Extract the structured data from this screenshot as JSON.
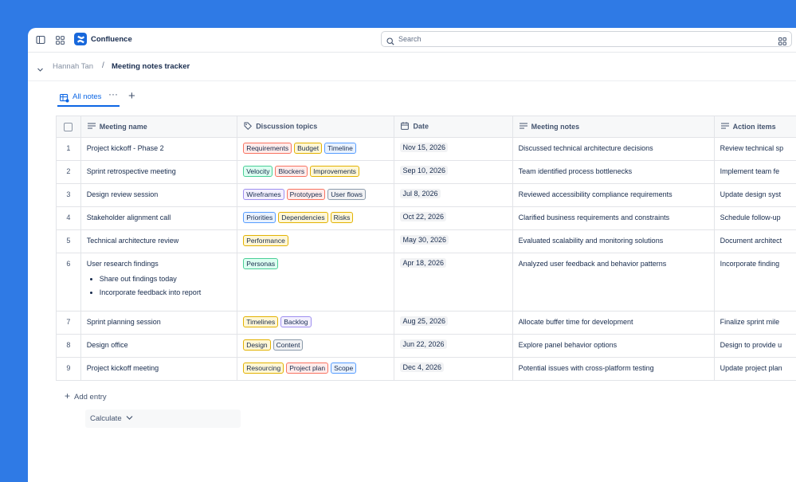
{
  "app": {
    "name": "Confluence",
    "brand_color": "#1868db",
    "background_color": "#2f7ae5"
  },
  "topbar": {
    "sidebar_toggle_icon": "sidebar-toggle-icon",
    "apps_icon": "apps-grid-icon",
    "search_placeholder": "Search",
    "search_icon": "search-icon",
    "search_right_icon": "filter-grid-icon"
  },
  "breadcrumb": {
    "user": "Hannah Tan",
    "separator": "/",
    "page": "Meeting notes tracker"
  },
  "tabs": {
    "active_label": "All notes",
    "more_label": "···",
    "add_label": "+"
  },
  "table": {
    "columns": [
      "Meeting name",
      "Discussion topics",
      "Date",
      "Meeting notes",
      "Action items"
    ],
    "rows": [
      {
        "num": "1",
        "name": "Project kickoff - Phase 2",
        "tags": [
          {
            "label": "Requirements",
            "color": "red"
          },
          {
            "label": "Budget",
            "color": "yellow"
          },
          {
            "label": "Timeline",
            "color": "blue"
          }
        ],
        "date": "Nov 15, 2026",
        "notes": "Discussed technical architecture decisions",
        "action": "Review technical sp"
      },
      {
        "num": "2",
        "name": "Sprint retrospective meeting",
        "tags": [
          {
            "label": "Velocity",
            "color": "green"
          },
          {
            "label": "Blockers",
            "color": "red"
          },
          {
            "label": "Improvements",
            "color": "yellow"
          }
        ],
        "date": "Sep 10, 2026",
        "notes": "Team identified process bottlenecks",
        "action": "Implement team fe"
      },
      {
        "num": "3",
        "name": "Design review session",
        "tags": [
          {
            "label": "Wireframes",
            "color": "purple"
          },
          {
            "label": "Prototypes",
            "color": "red"
          },
          {
            "label": "User flows",
            "color": "grey"
          }
        ],
        "date": "Jul 8, 2026",
        "notes": "Reviewed accessibility compliance requirements",
        "action": "Update design syst"
      },
      {
        "num": "4",
        "name": "Stakeholder alignment call",
        "tags": [
          {
            "label": "Priorities",
            "color": "blue"
          },
          {
            "label": "Dependencies",
            "color": "yellow"
          },
          {
            "label": "Risks",
            "color": "yellow"
          }
        ],
        "date": "Oct 22, 2026",
        "notes": "Clarified business requirements and constraints",
        "action": "Schedule follow-up"
      },
      {
        "num": "5",
        "name": "Technical architecture review",
        "tags": [
          {
            "label": "Performance",
            "color": "yellow"
          }
        ],
        "date": "May 30, 2026",
        "notes": "Evaluated scalability and monitoring solutions",
        "action": "Document architect"
      },
      {
        "num": "6",
        "name": "User research findings",
        "subitems": [
          "Share out findings today",
          "Incorporate feedback into report"
        ],
        "tags": [
          {
            "label": "Personas",
            "color": "green"
          }
        ],
        "date": "Apr 18, 2026",
        "notes": "Analyzed user feedback and behavior patterns",
        "action": "Incorporate finding"
      },
      {
        "num": "7",
        "name": "Sprint planning session",
        "tags": [
          {
            "label": "Timelines",
            "color": "yellow"
          },
          {
            "label": "Backlog",
            "color": "purple"
          }
        ],
        "date": "Aug 25, 2026",
        "notes": "Allocate buffer time for development",
        "action": "Finalize sprint mile"
      },
      {
        "num": "8",
        "name": "Design office",
        "tags": [
          {
            "label": "Design",
            "color": "yellow"
          },
          {
            "label": "Content",
            "color": "grey"
          }
        ],
        "date": "Jun 22, 2026",
        "notes": "Explore panel behavior options",
        "action": "Design to provide u"
      },
      {
        "num": "9",
        "name": "Project kickoff meeting",
        "tags": [
          {
            "label": "Resourcing",
            "color": "yellow"
          },
          {
            "label": "Project plan",
            "color": "red"
          },
          {
            "label": "Scope",
            "color": "blue"
          }
        ],
        "date": "Dec 4, 2026",
        "notes": "Potential issues with cross-platform testing",
        "action": "Update project plan"
      }
    ]
  },
  "add_entry": {
    "plus": "+",
    "label": "Add entry"
  },
  "calculate": {
    "label": "Calculate"
  }
}
